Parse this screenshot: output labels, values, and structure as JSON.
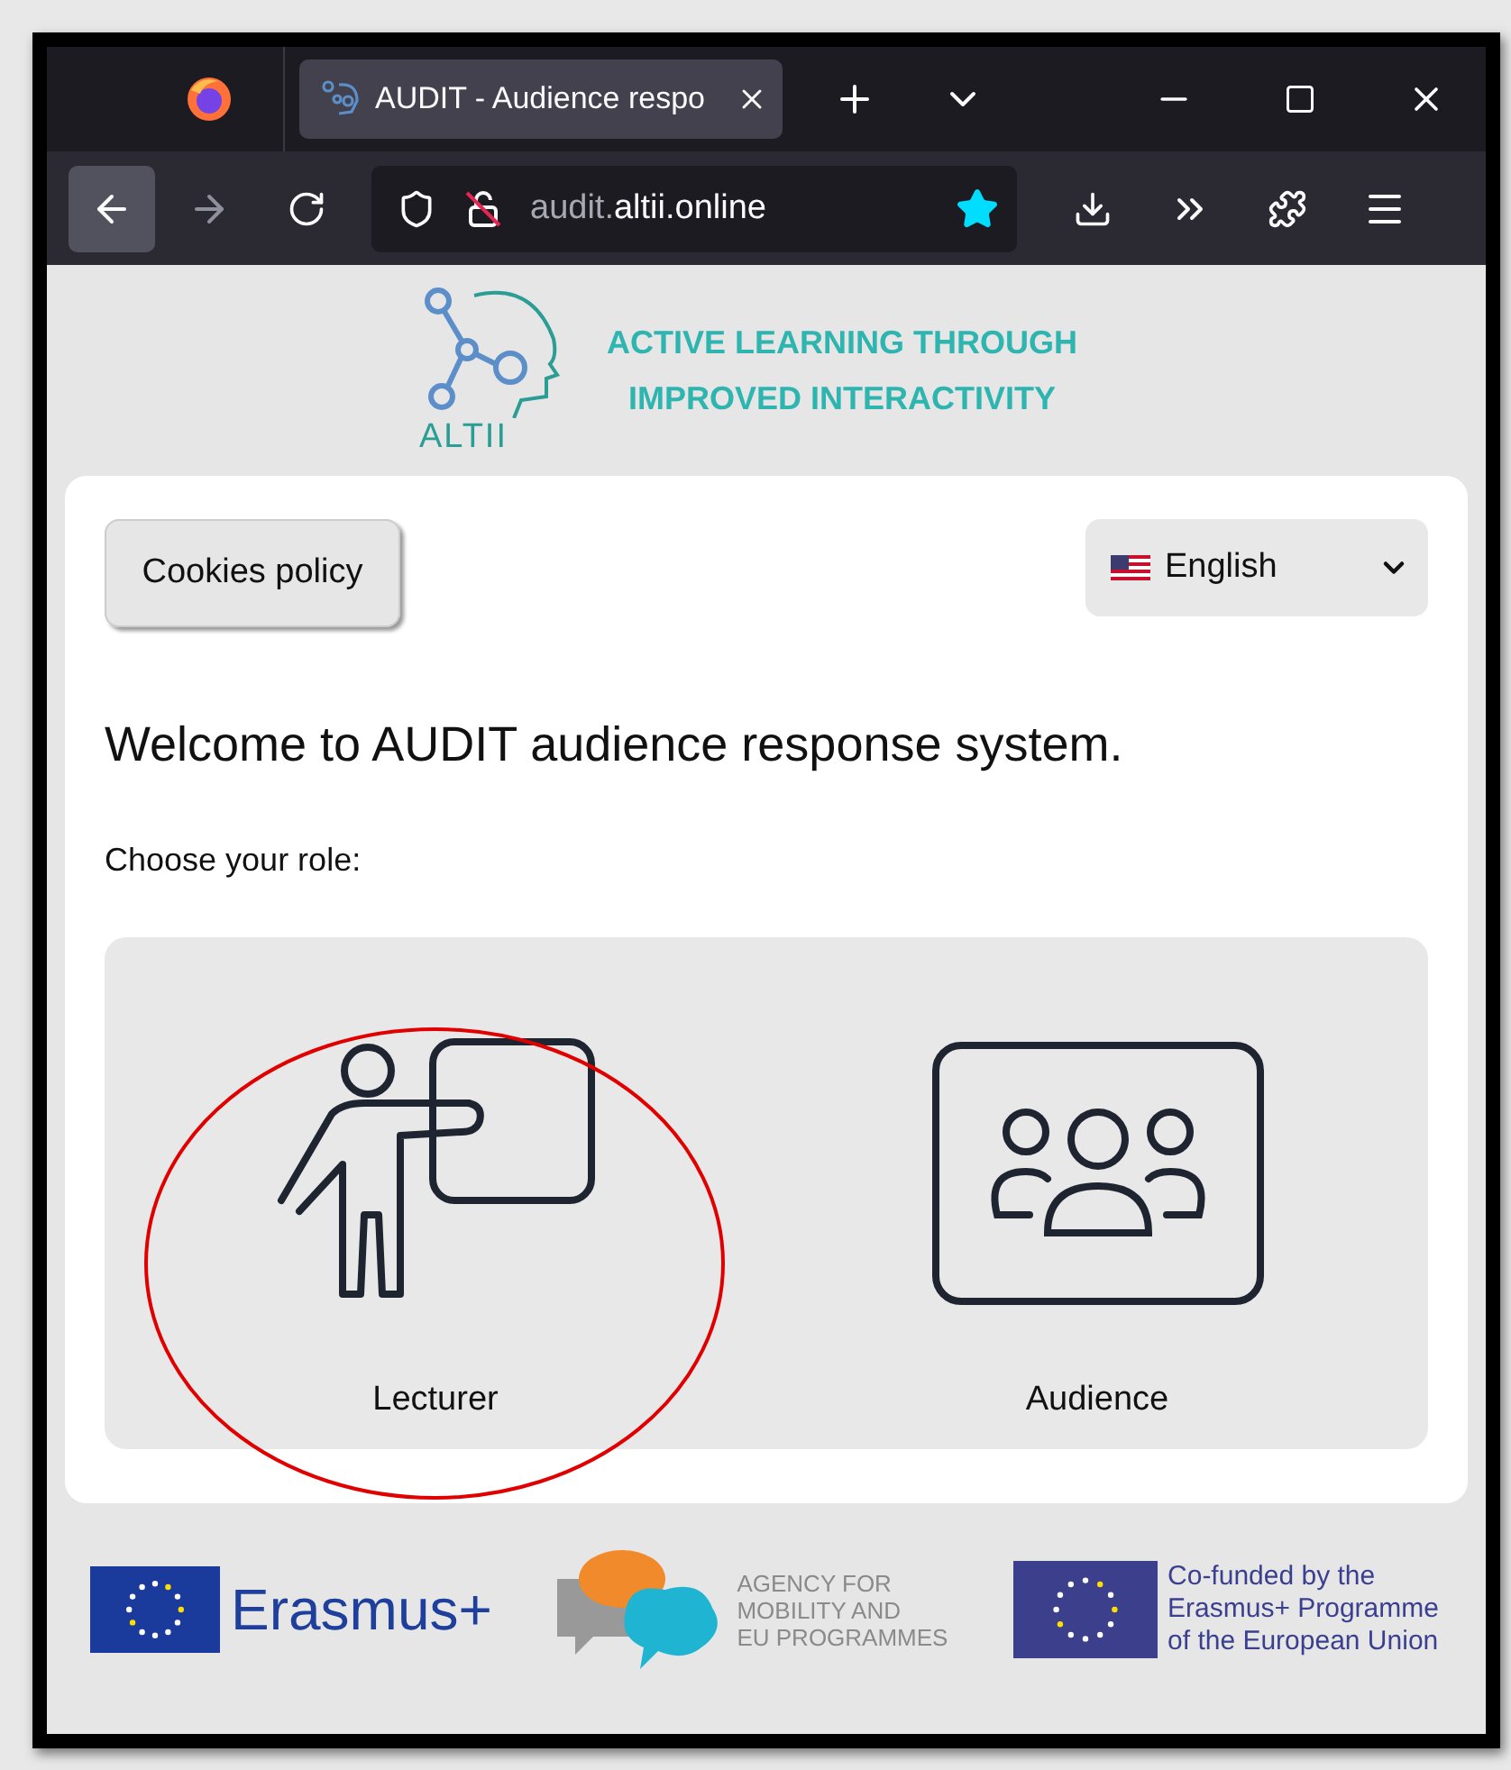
{
  "browser": {
    "tab": {
      "title": "AUDIT - Audience respo",
      "selected": true
    },
    "url": {
      "subdomain": "audit.",
      "domain": "altii.online"
    },
    "bookmarked": true
  },
  "header": {
    "logo_text": "ALTII",
    "tagline": [
      "ACTIVE LEARNING THROUGH",
      "IMPROVED INTERACTIVITY"
    ]
  },
  "cookies_button": "Cookies policy",
  "language": {
    "value": "English"
  },
  "heading": "Welcome to AUDIT audience response system.",
  "prompt": "Choose your role:",
  "roles": [
    {
      "kind": "lecturer",
      "label": "Lecturer",
      "highlighted": true
    },
    {
      "kind": "audience",
      "label": "Audience",
      "highlighted": false
    }
  ],
  "footer": {
    "erasmus": "Erasmus+",
    "agency": [
      "AGENCY FOR",
      "MOBILITY AND",
      "EU PROGRAMMES"
    ],
    "cofunded": [
      "Co-funded by the",
      "Erasmus+ Programme",
      "of the European Union"
    ]
  }
}
